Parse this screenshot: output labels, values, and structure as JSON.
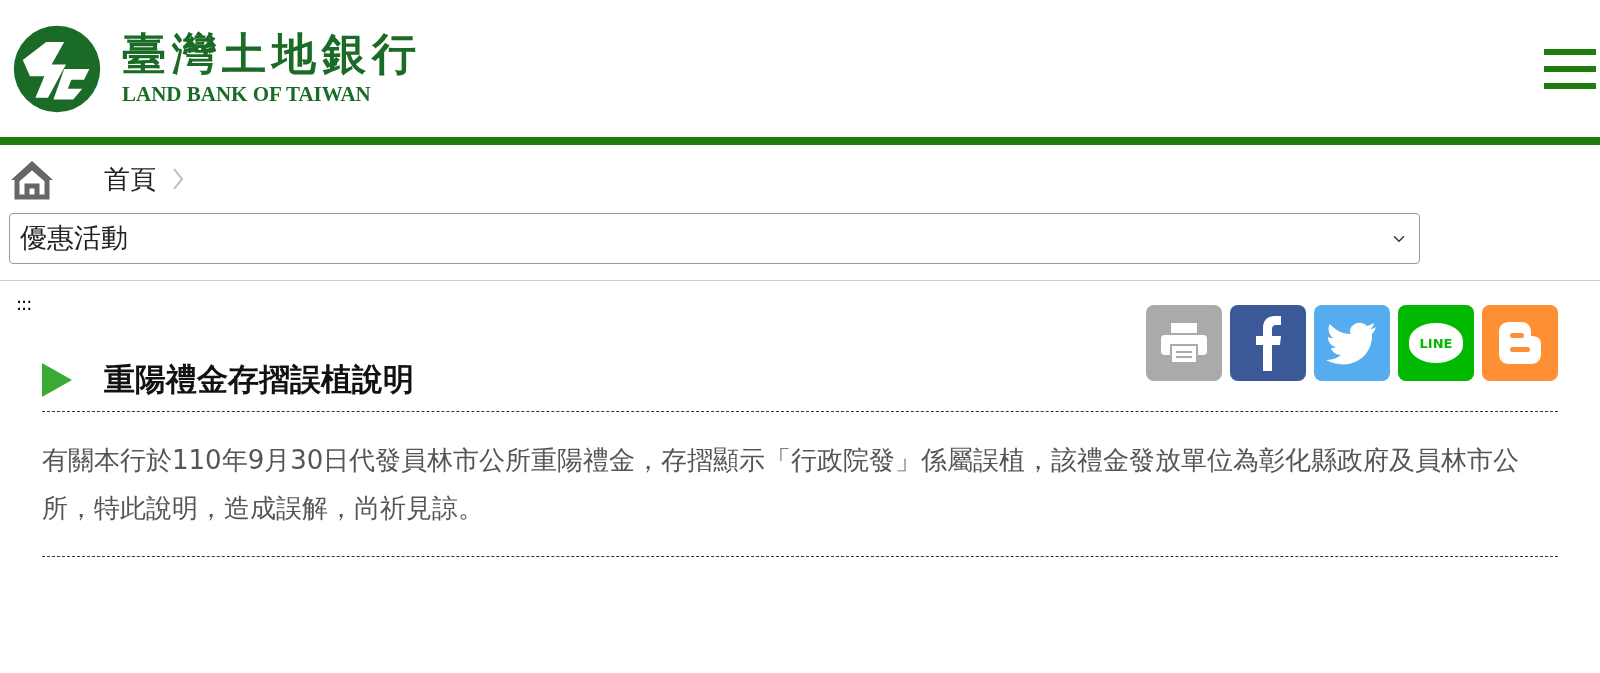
{
  "logo": {
    "chinese_name": "臺灣土地銀行",
    "english_name": "LAND BANK OF TAIWAN"
  },
  "breadcrumb": [
    {
      "label": "首頁"
    }
  ],
  "category_select": {
    "value": "優惠活動"
  },
  "accesskey": ":::",
  "share_buttons": [
    {
      "kind": "print"
    },
    {
      "kind": "facebook"
    },
    {
      "kind": "twitter"
    },
    {
      "kind": "line",
      "label": "LINE"
    },
    {
      "kind": "blogger"
    }
  ],
  "article": {
    "title": "重陽禮金存摺誤植說明",
    "body": "有關本行於110年9月30日代發員林市公所重陽禮金，存摺顯示「行政院發」係屬誤植，該禮金發放單位為彰化縣政府及員林市公所，特此說明，造成誤解，尚祈見諒。"
  }
}
